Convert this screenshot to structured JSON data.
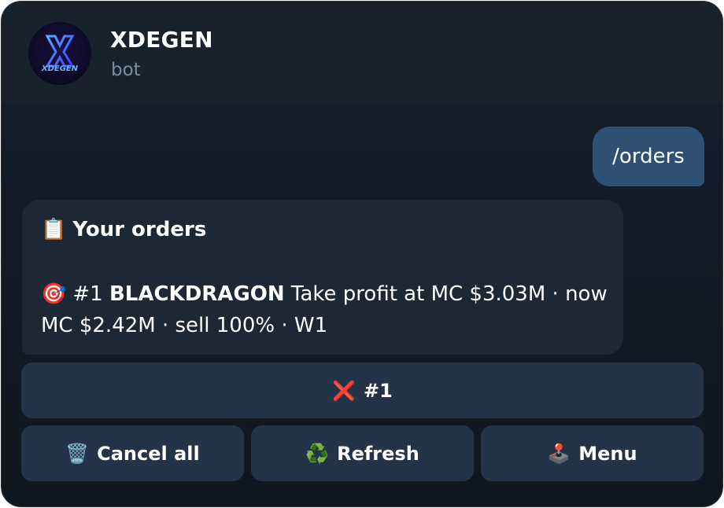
{
  "header": {
    "title": "XDEGEN",
    "subtitle": "bot",
    "avatar_text": "XDEGEN"
  },
  "messages": {
    "outgoing": "/orders",
    "incoming": {
      "title_icon": "📋",
      "title": "Your orders",
      "order_icon": "🎯",
      "order_number": "#1",
      "order_token": "BLACKDRAGON",
      "order_details": "Take profit at MC $3.03M · now MC $2.42M · sell 100% · W1"
    }
  },
  "keyboard": {
    "cancel_one": {
      "icon": "❌",
      "label": "#1"
    },
    "cancel_all": {
      "icon": "🗑️",
      "label": "Cancel all"
    },
    "refresh": {
      "icon": "♻️",
      "label": "Refresh"
    },
    "menu": {
      "icon": "🕹️",
      "label": "Menu"
    }
  },
  "colors": {
    "background": "#121c27",
    "header": "#18222d",
    "outgoing_bubble": "#2e5173",
    "incoming_bubble": "#1d2837",
    "button": "#233449",
    "accent_logo": "#3f7cff"
  }
}
